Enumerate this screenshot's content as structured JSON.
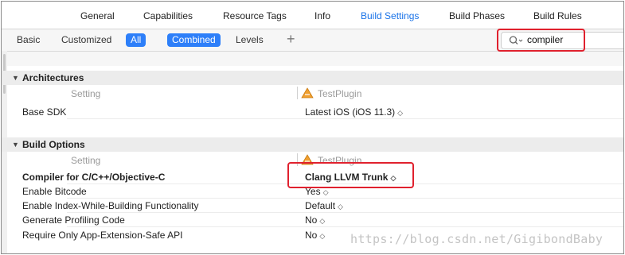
{
  "tabs": [
    "General",
    "Capabilities",
    "Resource Tags",
    "Info",
    "Build Settings",
    "Build Phases",
    "Build Rules"
  ],
  "active_tab": "Build Settings",
  "filter": {
    "basic": "Basic",
    "customized": "Customized",
    "all": "All",
    "combined": "Combined",
    "levels": "Levels",
    "add": "+",
    "search_value": "compiler"
  },
  "sections": {
    "architectures": {
      "title": "Architectures",
      "col_setting": "Setting",
      "target": "TestPlugin",
      "rows": [
        {
          "name": "Base SDK",
          "value": "Latest iOS (iOS 11.3)"
        }
      ]
    },
    "build_options": {
      "title": "Build Options",
      "col_setting": "Setting",
      "target": "TestPlugin",
      "rows": [
        {
          "name": "Compiler for C/C++/Objective-C",
          "value": "Clang LLVM Trunk"
        },
        {
          "name": "Enable Bitcode",
          "value": "Yes"
        },
        {
          "name": "Enable Index-While-Building Functionality",
          "value": "Default"
        },
        {
          "name": "Generate Profiling Code",
          "value": "No"
        },
        {
          "name": "Require Only App-Extension-Safe API",
          "value": "No"
        }
      ]
    }
  },
  "updown_glyph": "◇",
  "watermark": "https://blog.csdn.net/GigibondBaby",
  "colors": {
    "accent": "#2d7ff9",
    "highlight_box": "#e0212e"
  }
}
